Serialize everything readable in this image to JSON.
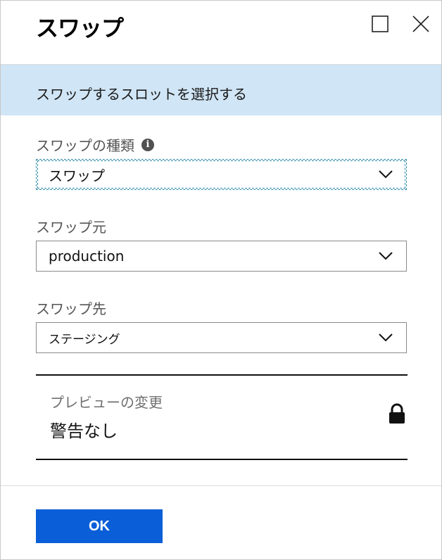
{
  "window": {
    "title": "スワップ",
    "maximize_icon": "maximize-icon",
    "close_icon": "close-icon"
  },
  "banner": {
    "text": "スワップするスロットを選択する"
  },
  "fields": {
    "swap_type": {
      "label": "スワップの種類",
      "value": "スワップ",
      "info_icon": "info-icon"
    },
    "source": {
      "label": "スワップ元",
      "value": "production"
    },
    "target": {
      "label": "スワップ先",
      "value": "ステージング"
    }
  },
  "preview": {
    "label": "プレビューの変更",
    "value": "警告なし",
    "lock_icon": "lock-icon"
  },
  "footer": {
    "ok_label": "OK"
  },
  "colors": {
    "banner_bg": "#d0e5f5",
    "primary_button": "#0a5fd8",
    "focus_border": "#2a8aa8"
  }
}
